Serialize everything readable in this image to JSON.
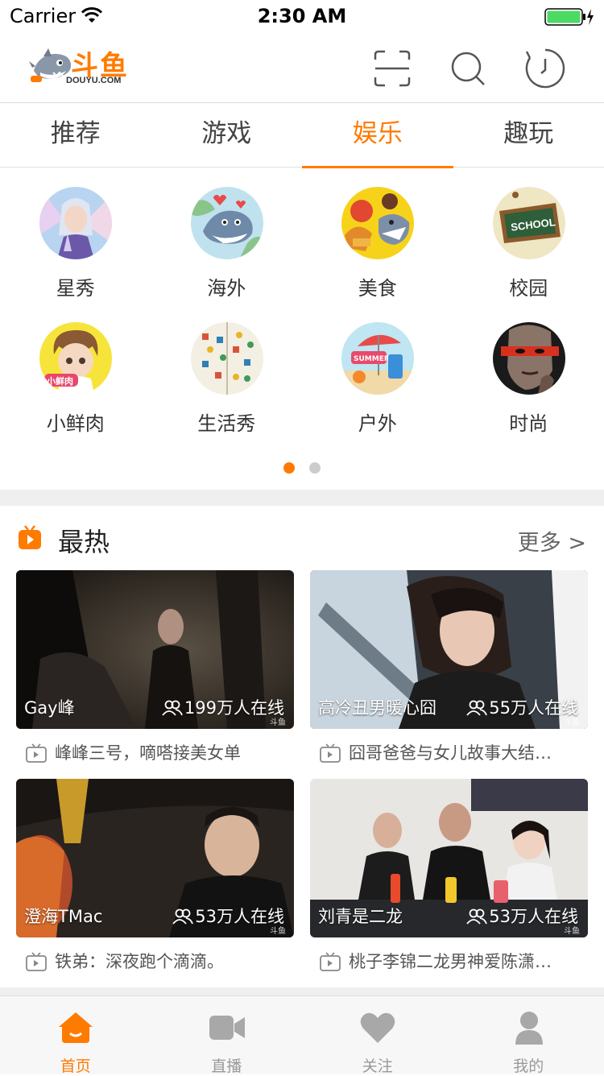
{
  "status_bar": {
    "carrier": "Carrier",
    "time": "2:30 AM"
  },
  "brand": {
    "name_cn": "斗鱼",
    "name_en": "DOUYU.COM"
  },
  "top_tabs": [
    {
      "label": "推荐",
      "active": false
    },
    {
      "label": "游戏",
      "active": false
    },
    {
      "label": "娱乐",
      "active": true
    },
    {
      "label": "趣玩",
      "active": false
    }
  ],
  "categories": [
    {
      "label": "星秀"
    },
    {
      "label": "海外"
    },
    {
      "label": "美食"
    },
    {
      "label": "校园"
    },
    {
      "label": "小鲜肉"
    },
    {
      "label": "生活秀"
    },
    {
      "label": "户外"
    },
    {
      "label": "时尚"
    }
  ],
  "category_art_text": {
    "school": "SCHOOL",
    "xiaoxianrou": "小鲜肉",
    "summer": "SUMMER"
  },
  "pager": {
    "pages": 2,
    "current": 1
  },
  "hot": {
    "title": "最热",
    "more": "更多 >",
    "rooms": [
      {
        "anchor": "Gay峰",
        "online": "199万人在线",
        "title": "峰峰三号，嘀嗒接美女单"
      },
      {
        "anchor": "高冷丑男暖心囧",
        "online": "55万人在线",
        "title": "囧哥爸爸与女儿故事大结…"
      },
      {
        "anchor": "澄海TMac",
        "online": "53万人在线",
        "title": "铁弟：深夜跑个滴滴。"
      },
      {
        "anchor": "刘青是二龙",
        "online": "53万人在线",
        "title": "桃子李锦二龙男神爱陈潇…"
      }
    ],
    "watermark": "斗鱼"
  },
  "tab_bar": [
    {
      "label": "首页",
      "icon": "home-icon",
      "active": true
    },
    {
      "label": "直播",
      "icon": "video-camera-icon",
      "active": false
    },
    {
      "label": "关注",
      "icon": "heart-icon",
      "active": false
    },
    {
      "label": "我的",
      "icon": "user-icon",
      "active": false
    }
  ],
  "colors": {
    "accent": "#ff7b00",
    "inactive": "#999999",
    "divider": "#efefef"
  }
}
